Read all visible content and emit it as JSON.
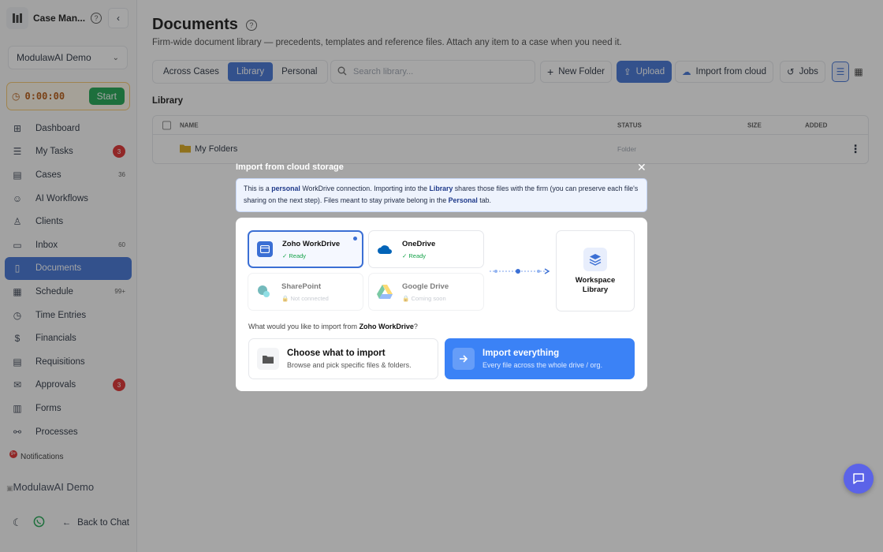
{
  "sidebar": {
    "app_title": "Case Man...",
    "org_select": "ModulawAI Demo",
    "timer": {
      "value": "0:00:00",
      "start_label": "Start"
    },
    "items": [
      {
        "label": "Dashboard",
        "icon": "grid-icon",
        "count": ""
      },
      {
        "label": "My Tasks",
        "icon": "checklist-icon",
        "count": "3",
        "badge": "red"
      },
      {
        "label": "Cases",
        "icon": "briefcase-icon",
        "count": "36"
      },
      {
        "label": "AI Workflows",
        "icon": "robot-icon",
        "count": ""
      },
      {
        "label": "Clients",
        "icon": "users-icon",
        "count": ""
      },
      {
        "label": "Inbox",
        "icon": "inbox-icon",
        "count": "60"
      },
      {
        "label": "Documents",
        "icon": "document-icon",
        "count": "",
        "active": true
      },
      {
        "label": "Schedule",
        "icon": "calendar-icon",
        "count": "99+"
      },
      {
        "label": "Time Entries",
        "icon": "clock-icon",
        "count": ""
      },
      {
        "label": "Financials",
        "icon": "dollar-icon",
        "count": ""
      },
      {
        "label": "Requisitions",
        "icon": "receipt-icon",
        "count": ""
      },
      {
        "label": "Approvals",
        "icon": "approval-icon",
        "count": "3",
        "badge": "red"
      },
      {
        "label": "Forms",
        "icon": "form-icon",
        "count": ""
      },
      {
        "label": "Processes",
        "icon": "process-icon",
        "count": ""
      }
    ],
    "notifications_label": "Notifications",
    "notifications_count": "9+",
    "org_image_alt": "ModulawAI Demo",
    "back_label": "Back to Chat"
  },
  "main": {
    "title": "Documents",
    "subtitle": "Firm-wide document library — precedents, templates and reference files. Attach any item to a case when you need it.",
    "tabs": [
      "Across Cases",
      "Library",
      "Personal"
    ],
    "active_tab": "Library",
    "search_placeholder": "Search library...",
    "buttons": {
      "new_folder": "New Folder",
      "upload": "Upload",
      "import_cloud": "Import from cloud",
      "jobs": "Jobs"
    },
    "section_label": "Library",
    "table": {
      "columns": [
        "NAME",
        "STATUS",
        "SIZE",
        "ADDED"
      ],
      "rows": [
        {
          "name": "My Folders",
          "status": "Folder"
        }
      ]
    }
  },
  "modal": {
    "title": "Import from cloud storage",
    "info": {
      "p1": "This is a ",
      "b1": "personal",
      "p2": " WorkDrive connection. Importing into the ",
      "b2": "Library",
      "p3": " shares those files with the firm (you can preserve each file's sharing on the next step). Files meant to stay private belong in the ",
      "b3": "Personal",
      "p4": " tab."
    },
    "providers": [
      {
        "name": "Zoho WorkDrive",
        "status": "Ready"
      },
      {
        "name": "OneDrive",
        "status": "Ready"
      },
      {
        "name": "SharePoint",
        "status": "Not connected"
      },
      {
        "name": "Google Drive",
        "status": "Coming soon"
      }
    ],
    "destination": "Workspace Library",
    "question_prefix": "What would you like to import from ",
    "question_bold": "Zoho WorkDrive",
    "question_suffix": "?",
    "options": [
      {
        "title": "Choose what to import",
        "subtitle": "Browse and pick specific files & folders."
      },
      {
        "title": "Import everything",
        "subtitle": "Every file across the whole drive / org."
      }
    ]
  },
  "colors": {
    "accent": "#3b6fd4",
    "import_all": "#3b82f6",
    "ready": "#16a34a",
    "timer_start": "#16a34a",
    "badge": "#dc2626"
  }
}
